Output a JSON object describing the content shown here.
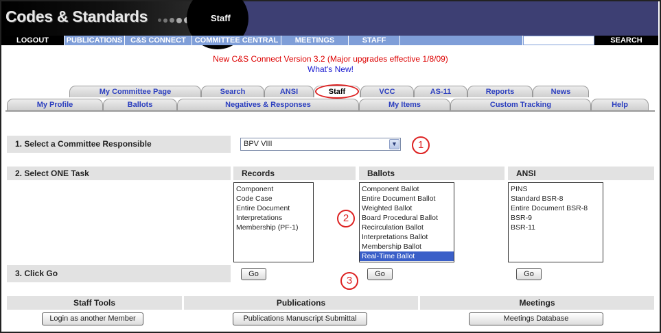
{
  "banner": {
    "app_title": "Codes & Standards",
    "section_title": "Staff"
  },
  "navbar": {
    "items": [
      {
        "label": "LOGOUT"
      },
      {
        "label": "PUBLICATIONS"
      },
      {
        "label": "C&S CONNECT"
      },
      {
        "label": "COMMITTEE CENTRAL"
      },
      {
        "label": "MEETINGS"
      },
      {
        "label": "STAFF"
      }
    ],
    "search_label": "SEARCH"
  },
  "announcement": {
    "version_text": "New C&S Connect Version 3.2 (Major upgrades effective 1/8/09)",
    "whats_new": "What's New!"
  },
  "tabs_row1": [
    "My Committee Page",
    "Search",
    "ANSI",
    "Staff",
    "VCC",
    "AS-11",
    "Reports",
    "News"
  ],
  "tabs_row2": [
    "My Profile",
    "Ballots",
    "Negatives & Responses",
    "My Items",
    "Custom Tracking",
    "Help"
  ],
  "step1": {
    "label": "1. Select a Committee Responsible",
    "selected": "BPV VIII"
  },
  "step2": {
    "label": "2. Select ONE Task",
    "records": {
      "header": "Records",
      "options": [
        "Component",
        "Code Case",
        "Entire Document",
        "Interpretations",
        "Membership (PF-1)"
      ]
    },
    "ballots": {
      "header": "Ballots",
      "options": [
        "Component Ballot",
        "Entire Document Ballot",
        "Weighted Ballot",
        "Board Procedural Ballot",
        "Recirculation Ballot",
        "Interpretations Ballot",
        "Membership Ballot",
        "Real-Time Ballot"
      ],
      "selected": "Real-Time Ballot"
    },
    "ansi": {
      "header": "ANSI",
      "options": [
        "PINS",
        "Standard BSR-8",
        "Entire Document BSR-8",
        "BSR-9",
        "BSR-11"
      ]
    }
  },
  "step3": {
    "label": "3. Click Go",
    "go_label": "Go"
  },
  "callouts": {
    "one": "1",
    "two": "2",
    "three": "3"
  },
  "tools": {
    "staff_tools": {
      "header": "Staff Tools",
      "button": "Login as another Member"
    },
    "publications": {
      "header": "Publications",
      "button": "Publications Manuscript Submittal"
    },
    "meetings": {
      "header": "Meetings",
      "button": "Meetings Database"
    }
  },
  "colors": {
    "banner": "#3d3f73",
    "nav_blue": "#7f9ed8",
    "tab_text": "#2c3fbf",
    "callout_red": "#dd2222",
    "selection": "#3a5fc8"
  }
}
